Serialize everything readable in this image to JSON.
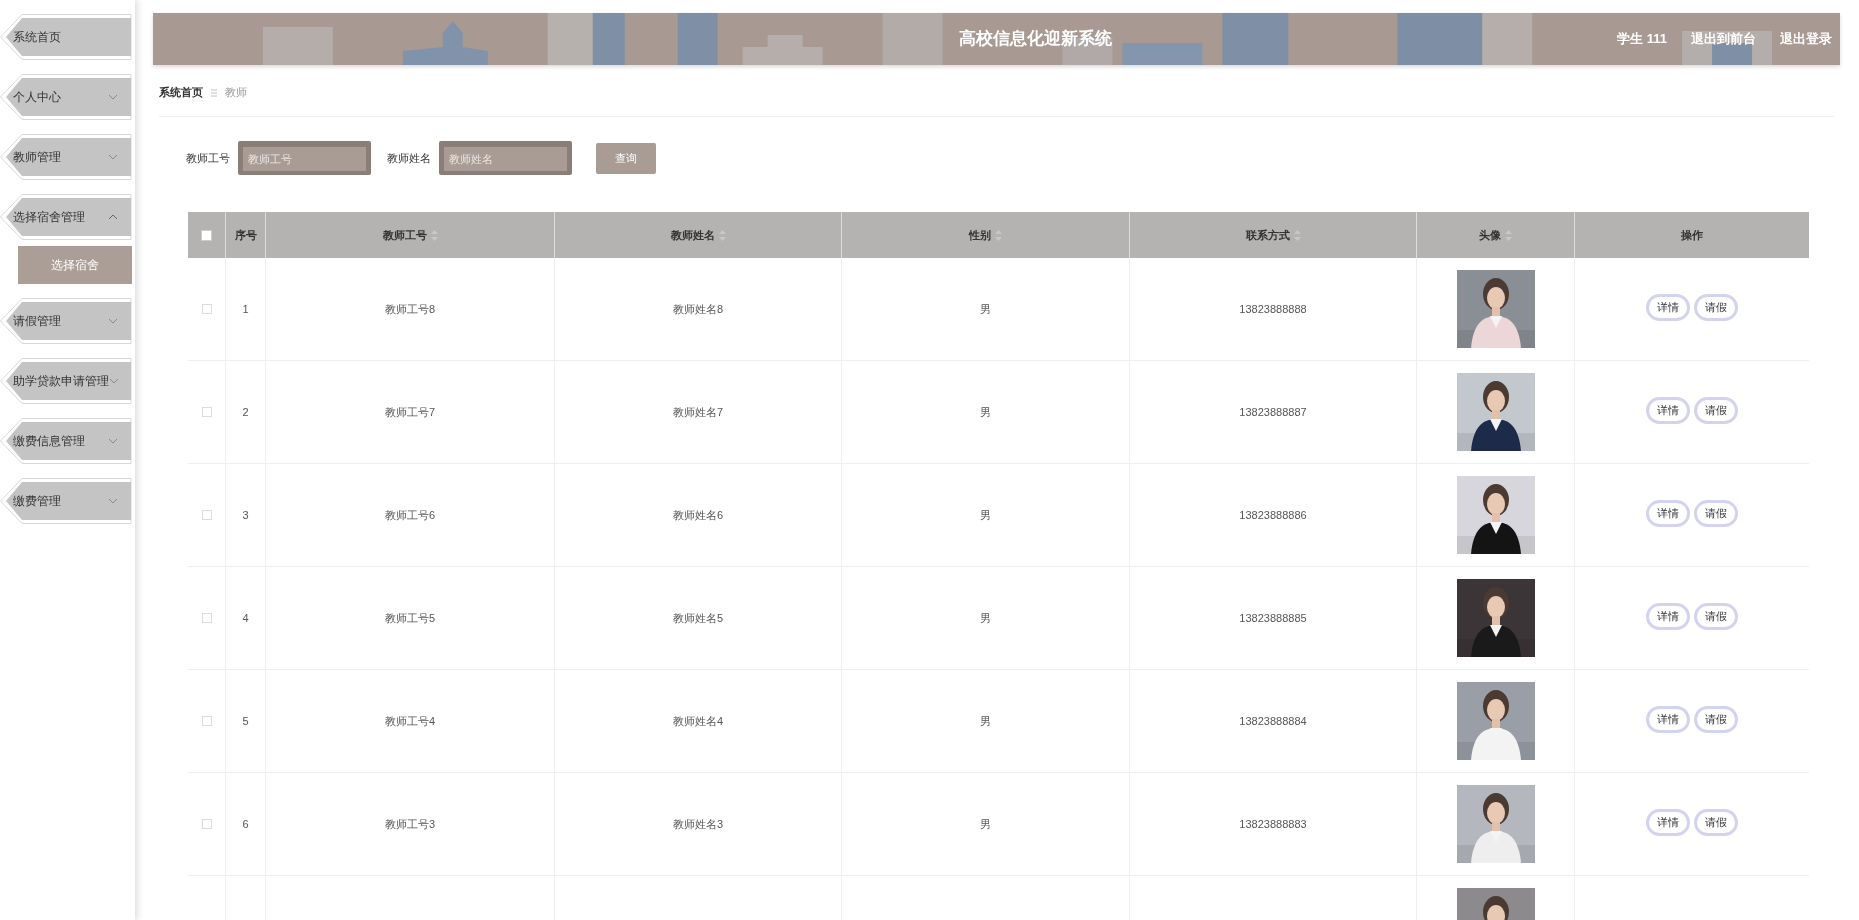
{
  "sidebar": {
    "items": [
      {
        "label": "系统首页",
        "kind": "link"
      },
      {
        "label": "个人中心",
        "kind": "menu",
        "expanded": false
      },
      {
        "label": "教师管理",
        "kind": "menu",
        "expanded": false
      },
      {
        "label": "选择宿舍管理",
        "kind": "menu",
        "expanded": true,
        "children": [
          {
            "label": "选择宿舍",
            "selected": true
          }
        ]
      },
      {
        "label": "请假管理",
        "kind": "menu",
        "expanded": false
      },
      {
        "label": "助学贷款申请管理",
        "kind": "menu",
        "expanded": false
      },
      {
        "label": "缴费信息管理",
        "kind": "menu",
        "expanded": false
      },
      {
        "label": "缴费管理",
        "kind": "menu",
        "expanded": false
      }
    ]
  },
  "header": {
    "title": "高校信息化迎新系统",
    "user": "学生 111",
    "links": [
      "退出到前台",
      "退出登录"
    ]
  },
  "breadcrumb": [
    "系统首页",
    "教师"
  ],
  "search": {
    "fields": [
      {
        "label": "教师工号",
        "placeholder": "教师工号"
      },
      {
        "label": "教师姓名",
        "placeholder": "教师姓名"
      }
    ],
    "button": "查询"
  },
  "table": {
    "select_all": {
      "checked": false
    },
    "columns": [
      {
        "label": "序号",
        "sortable": false
      },
      {
        "label": "教师工号",
        "sortable": true
      },
      {
        "label": "教师姓名",
        "sortable": true
      },
      {
        "label": "性别",
        "sortable": true
      },
      {
        "label": "联系方式",
        "sortable": true
      },
      {
        "label": "头像",
        "sortable": true
      },
      {
        "label": "操作",
        "sortable": false
      }
    ],
    "rows": [
      {
        "checked": false,
        "cells": [
          "1",
          "教师工号8",
          "教师姓名8",
          "男",
          "13823888888"
        ],
        "actions": [
          "详情",
          "请假"
        ]
      },
      {
        "checked": false,
        "cells": [
          "2",
          "教师工号7",
          "教师姓名7",
          "男",
          "13823888887"
        ],
        "actions": [
          "详情",
          "请假"
        ]
      },
      {
        "checked": false,
        "cells": [
          "3",
          "教师工号6",
          "教师姓名6",
          "男",
          "13823888886"
        ],
        "actions": [
          "详情",
          "请假"
        ]
      },
      {
        "checked": false,
        "cells": [
          "4",
          "教师工号5",
          "教师姓名5",
          "男",
          "13823888885"
        ],
        "actions": [
          "详情",
          "请假"
        ]
      },
      {
        "checked": false,
        "cells": [
          "5",
          "教师工号4",
          "教师姓名4",
          "男",
          "13823888884"
        ],
        "actions": [
          "详情",
          "请假"
        ]
      },
      {
        "checked": false,
        "cells": [
          "6",
          "教师工号3",
          "教师姓名3",
          "男",
          "13823888883"
        ],
        "actions": [
          "详情",
          "请假"
        ]
      }
    ]
  }
}
